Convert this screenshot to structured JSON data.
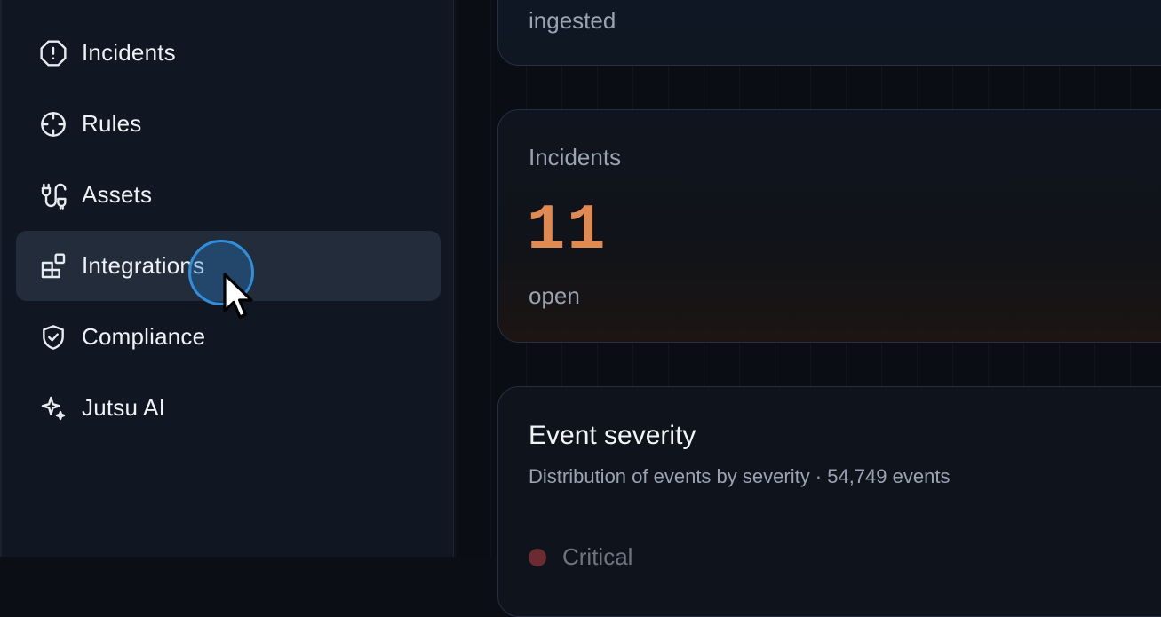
{
  "sidebar": {
    "items": [
      {
        "label": "Incidents",
        "icon": "alert-octagon-icon",
        "active": false
      },
      {
        "label": "Rules",
        "icon": "crosshair-icon",
        "active": false
      },
      {
        "label": "Assets",
        "icon": "plug-icon",
        "active": false
      },
      {
        "label": "Integrations",
        "icon": "blocks-icon",
        "active": true
      },
      {
        "label": "Compliance",
        "icon": "shield-check-icon",
        "active": false
      },
      {
        "label": "Jutsu AI",
        "icon": "sparkles-icon",
        "active": false
      }
    ]
  },
  "cards": {
    "top": {
      "subtitle": "ingested"
    },
    "incidents": {
      "label": "Incidents",
      "value": "11",
      "subtitle": "open"
    },
    "severity": {
      "title": "Event severity",
      "description": "Distribution of events by severity · 54,749 events",
      "legend": [
        {
          "label": "Critical",
          "color": "#6b2b30"
        }
      ]
    }
  },
  "colors": {
    "accent_orange": "#e08a53",
    "cursor_blue": "#2f8fdc",
    "sidebar_bg": "#111722",
    "active_bg": "#232c3a"
  }
}
